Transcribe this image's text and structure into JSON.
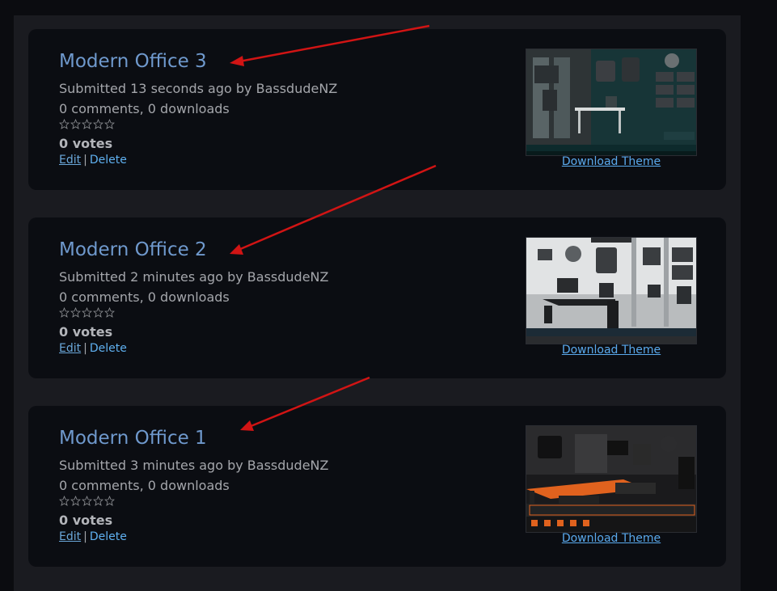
{
  "colors": {
    "background": "#0b0c10",
    "panel": "#1a1b20",
    "card": "#0b0d12",
    "title": "#6f99cd",
    "meta_text": "#a4a6ab",
    "link": "#5aa9ec",
    "arrow": "#d11414"
  },
  "themes": [
    {
      "title": "Modern Office 3",
      "submitted": "Submitted 13 seconds ago by BassdudeNZ",
      "counts": "0 comments, 0 downloads",
      "votes": "0 votes",
      "edit_label": "Edit",
      "delete_label": "Delete",
      "download_label": "Download Theme",
      "thumbnail_icon": "teal-office-desktop-thumbnail",
      "rating_stars": 0
    },
    {
      "title": "Modern Office 2",
      "submitted": "Submitted 2 minutes ago by BassdudeNZ",
      "counts": "0 comments, 0 downloads",
      "votes": "0 votes",
      "edit_label": "Edit",
      "delete_label": "Delete",
      "download_label": "Download Theme",
      "thumbnail_icon": "white-office-desktop-thumbnail",
      "rating_stars": 0
    },
    {
      "title": "Modern Office 1",
      "submitted": "Submitted 3 minutes ago by BassdudeNZ",
      "counts": "0 comments, 0 downloads",
      "votes": "0 votes",
      "edit_label": "Edit",
      "delete_label": "Delete",
      "download_label": "Download Theme",
      "thumbnail_icon": "orange-office-desktop-thumbnail",
      "rating_stars": 0
    }
  ],
  "separator": "|"
}
